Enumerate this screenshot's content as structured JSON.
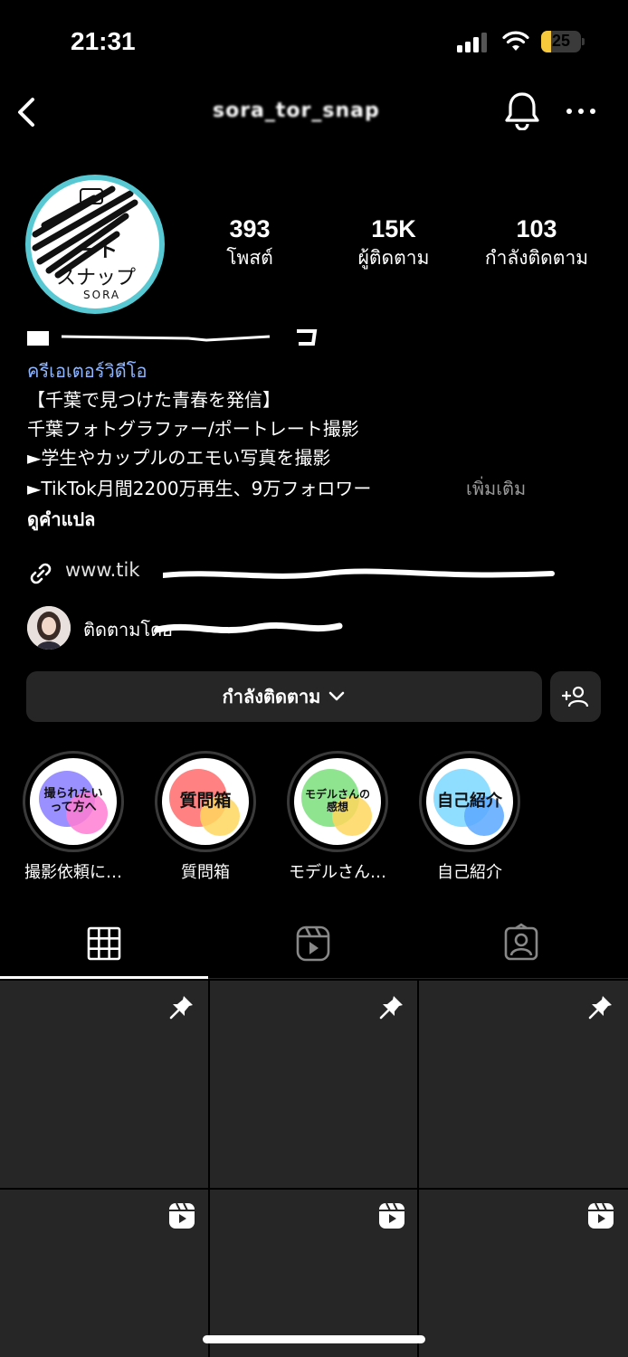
{
  "status_bar": {
    "time": "21:31",
    "battery": "25",
    "battery_level": 0.25,
    "battery_color": "#f6c83b"
  },
  "header": {
    "username": "sora_tor_snap"
  },
  "profile": {
    "stats": [
      {
        "count": "393",
        "label": "โพสต์"
      },
      {
        "count": "15K",
        "label": "ผู้ติดตาม"
      },
      {
        "count": "103",
        "label": "กำลังติดตาม"
      }
    ],
    "avatar_text": {
      "line1": "ート",
      "line2": "スナップ",
      "line3": "SORA"
    }
  },
  "bio": {
    "category": "ครีเอเตอร์วิดีโอ",
    "lines": [
      "【千葉で見つけた青春を発信】",
      "千葉フォトグラファー/ポートレート撮影",
      "►学生やカップルのエモい写真を撮影",
      "►TikTok月間2200万再生、9万フォロワー"
    ],
    "more": "เพิ่มเติม",
    "translate": "ดูคำแปล",
    "link": "www.tik"
  },
  "followed_by": {
    "text": "ติดตามโดย"
  },
  "actions": {
    "following": "กำลังติดตาม"
  },
  "highlights": [
    {
      "label": "撮影依頼に…",
      "cover": "撮られたい\nって方へ",
      "c1": "#8a7cff",
      "c2": "#ff7cd4"
    },
    {
      "label": "質問箱",
      "cover": "質問箱",
      "c1": "#ff6b6b",
      "c2": "#ffd75e"
    },
    {
      "label": "モデルさん…",
      "cover": "モデルさんの\n感想",
      "c1": "#7be07b",
      "c2": "#ffd75e"
    },
    {
      "label": "自己紹介",
      "cover": "自己紹介",
      "c1": "#7bd7ff",
      "c2": "#5aa8ff"
    }
  ],
  "tabs": [
    {
      "name": "grid"
    },
    {
      "name": "reels"
    },
    {
      "name": "tagged"
    }
  ],
  "grid": [
    {
      "icon": "pin-icon"
    },
    {
      "icon": "pin-icon"
    },
    {
      "icon": "pin-icon"
    },
    {
      "icon": "reel-icon"
    },
    {
      "icon": "reel-icon"
    },
    {
      "icon": "reel-icon"
    }
  ]
}
